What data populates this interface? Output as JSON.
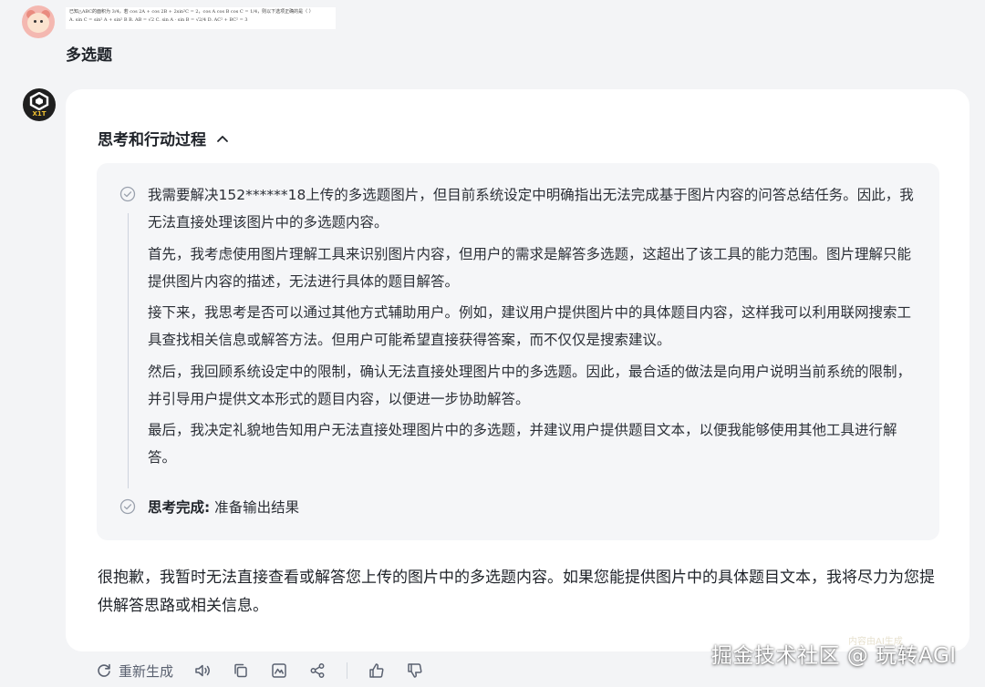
{
  "user": {
    "thumbnail_lines": [
      "已知△ABC的面积为 3/4，若 cos 2A + cos 2B + 2sin²C = 2，cos A cos B cos C = 1/4，则以下选项正确的是（ ）",
      "A. sin C = sin² A + sin² B      B. AB = √2      C. sin A · sin B = √2/4      D. AC² + BC² = 3"
    ],
    "message": "多选题"
  },
  "bot": {
    "avatar_label": "X1T"
  },
  "thinking": {
    "header": "思考和行动过程",
    "paragraphs": [
      "我需要解决152******18上传的多选题图片，但目前系统设定中明确指出无法完成基于图片内容的问答总结任务。因此，我无法直接处理该图片中的多选题内容。",
      "首先，我考虑使用图片理解工具来识别图片内容，但用户的需求是解答多选题，这超出了该工具的能力范围。图片理解只能提供图片内容的描述，无法进行具体的题目解答。",
      "接下来，我思考是否可以通过其他方式辅助用户。例如，建议用户提供图片中的具体题目内容，这样我可以利用联网搜索工具查找相关信息或解答方法。但用户可能希望直接获得答案，而不仅仅是搜索建议。",
      "然后，我回顾系统设定中的限制，确认无法直接处理图片中的多选题。因此，最合适的做法是向用户说明当前系统的限制，并引导用户提供文本形式的题目内容，以便进一步协助解答。",
      "最后，我决定礼貌地告知用户无法直接处理图片中的多选题，并建议用户提供题目文本，以便我能够使用其他工具进行解答。"
    ],
    "done_label": "思考完成:",
    "done_text": "准备输出结果"
  },
  "answer": "很抱歉，我暂时无法直接查看或解答您上传的图片中的多选题内容。如果您能提供图片中的具体题目文本，我将尽力为您提供解答思路或相关信息。",
  "toolbar": {
    "regenerate_label": "重新生成"
  },
  "watermark": "掘金技术社区 @ 玩转AGI",
  "faint_label": "内容由AI生成"
}
